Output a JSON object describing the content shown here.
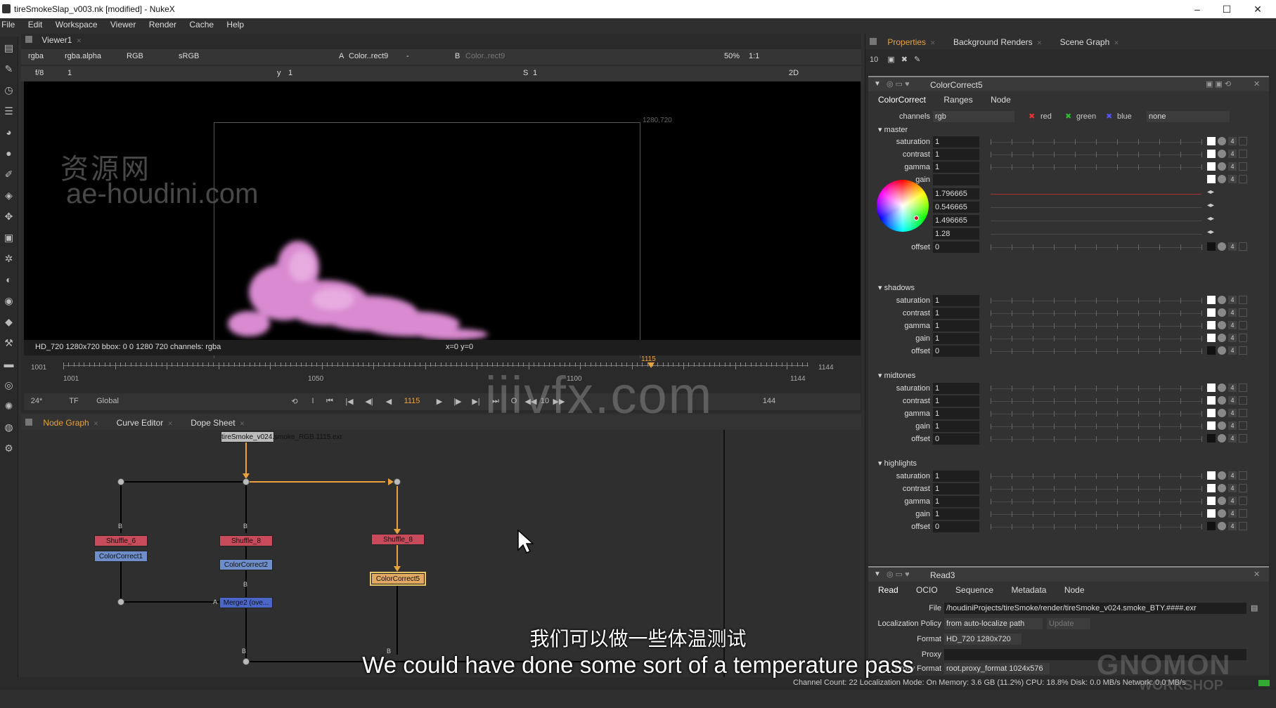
{
  "window": {
    "title": "tireSmokeSlap_v003.nk [modified] - NukeX",
    "min": "–",
    "max": "☐",
    "close": "✕"
  },
  "menu": [
    "File",
    "Edit",
    "Workspace",
    "Viewer",
    "Render",
    "Cache",
    "Help"
  ],
  "viewer": {
    "tab": "Viewer1",
    "channels": "rgba",
    "alpha": "rgba.alpha",
    "display": "RGB",
    "lut": "sRGB",
    "inputA_label": "A",
    "inputA": "Color..rect9",
    "inputA_extra": "-",
    "inputB_label": "B",
    "inputB": "Color..rect9",
    "zoom": "50%",
    "ratio": "1:1",
    "fstop": "f/8",
    "frame_field": "1",
    "y_label": "y",
    "y_value": "1",
    "s_label": "S",
    "s_value": "1",
    "view_mode": "2D",
    "res_label": "1280,720",
    "info": "HD_720 1280x720  bbox: 0 0 1280 720  channels: rgba",
    "coords": "x=0 y=0",
    "watermark_cn": "资源网",
    "watermark_url": "ae-houdini.com"
  },
  "timeline": {
    "start": "1001",
    "start_inner": "1001",
    "mark1": "1050",
    "mark2": "1100",
    "end_inner": "1144",
    "end": "1144",
    "current": "1115",
    "fps": "24*",
    "tf": "TF",
    "scope": "Global",
    "frame_display": "1115",
    "step": "10",
    "end_field": "144",
    "watermark": "iiivfx.com"
  },
  "nodegraph": {
    "tabs": [
      "Node Graph",
      "Curve Editor",
      "Dope Sheet"
    ],
    "read_node": "tireSmoke_v024.smoke_RGB.1115.exr",
    "nodes": {
      "shuffle6": "Shuffle_6",
      "shuffle8a": "Shuffle_8",
      "shuffle8b": "Shuffle_8",
      "cc1": "ColorCorrect1",
      "cc2": "ColorCorrect2",
      "cc5": "ColorCorrect5",
      "merge": "Merge2 (ove..."
    },
    "input_b": "B",
    "input_a": "A"
  },
  "properties": {
    "tabs": [
      "Properties",
      "Background Renders",
      "Scene Graph"
    ],
    "max_panels": "10",
    "colorcorrect": {
      "name": "ColorCorrect5",
      "tabs": [
        "ColorCorrect",
        "Ranges",
        "Node"
      ],
      "channels_label": "channels",
      "channels": "rgb",
      "red": "red",
      "green": "green",
      "blue": "blue",
      "extra_channel": "none",
      "master_label": "master",
      "master": [
        {
          "k": "saturation",
          "v": "1"
        },
        {
          "k": "contrast",
          "v": "1"
        },
        {
          "k": "gamma",
          "v": "1"
        },
        {
          "k": "gain",
          "v": ""
        }
      ],
      "gain_rgba": [
        "1.796665",
        "0.546665",
        "1.496665",
        "1.28"
      ],
      "master_offset": {
        "k": "offset",
        "v": "0"
      },
      "shadows_label": "shadows",
      "midtones_label": "midtones",
      "highlights_label": "highlights",
      "range_rows": [
        {
          "k": "saturation",
          "v": "1"
        },
        {
          "k": "contrast",
          "v": "1"
        },
        {
          "k": "gamma",
          "v": "1"
        },
        {
          "k": "gain",
          "v": "1"
        },
        {
          "k": "offset",
          "v": "0"
        }
      ],
      "btn4": "4"
    },
    "read": {
      "name": "Read3",
      "tabs": [
        "Read",
        "OCIO",
        "Sequence",
        "Metadata",
        "Node"
      ],
      "file_label": "File",
      "file": "/houdiniProjects/tireSmoke/render/tireSmoke_v024.smoke_BTY.####.exr",
      "loc_label": "Localization Policy",
      "loc": "from auto-localize path",
      "update": "Update",
      "format_label": "Format",
      "format": "HD_720 1280x720",
      "proxy_label": "Proxy",
      "proxy_format_label": "Proxy Format",
      "proxy_format": "root.proxy_format 1024x576"
    }
  },
  "status": "Channel Count: 22  Localization Mode: On  Memory: 3.6 GB (11.2%)  CPU: 18.8%  Disk: 0.0 MB/s  Network: 0.0 MB/s",
  "subtitles": {
    "cn": "我们可以做一些体温测试",
    "en": "We could have done some sort of a temperature pass"
  },
  "brand": {
    "name": "GNOMON",
    "sub": "WORKSHOP"
  },
  "colors": {
    "accent": "#e9a23b",
    "node_shuffle": "#c84b5c",
    "node_cc": "#6d8ec9",
    "node_merge": "#4a67c7"
  }
}
